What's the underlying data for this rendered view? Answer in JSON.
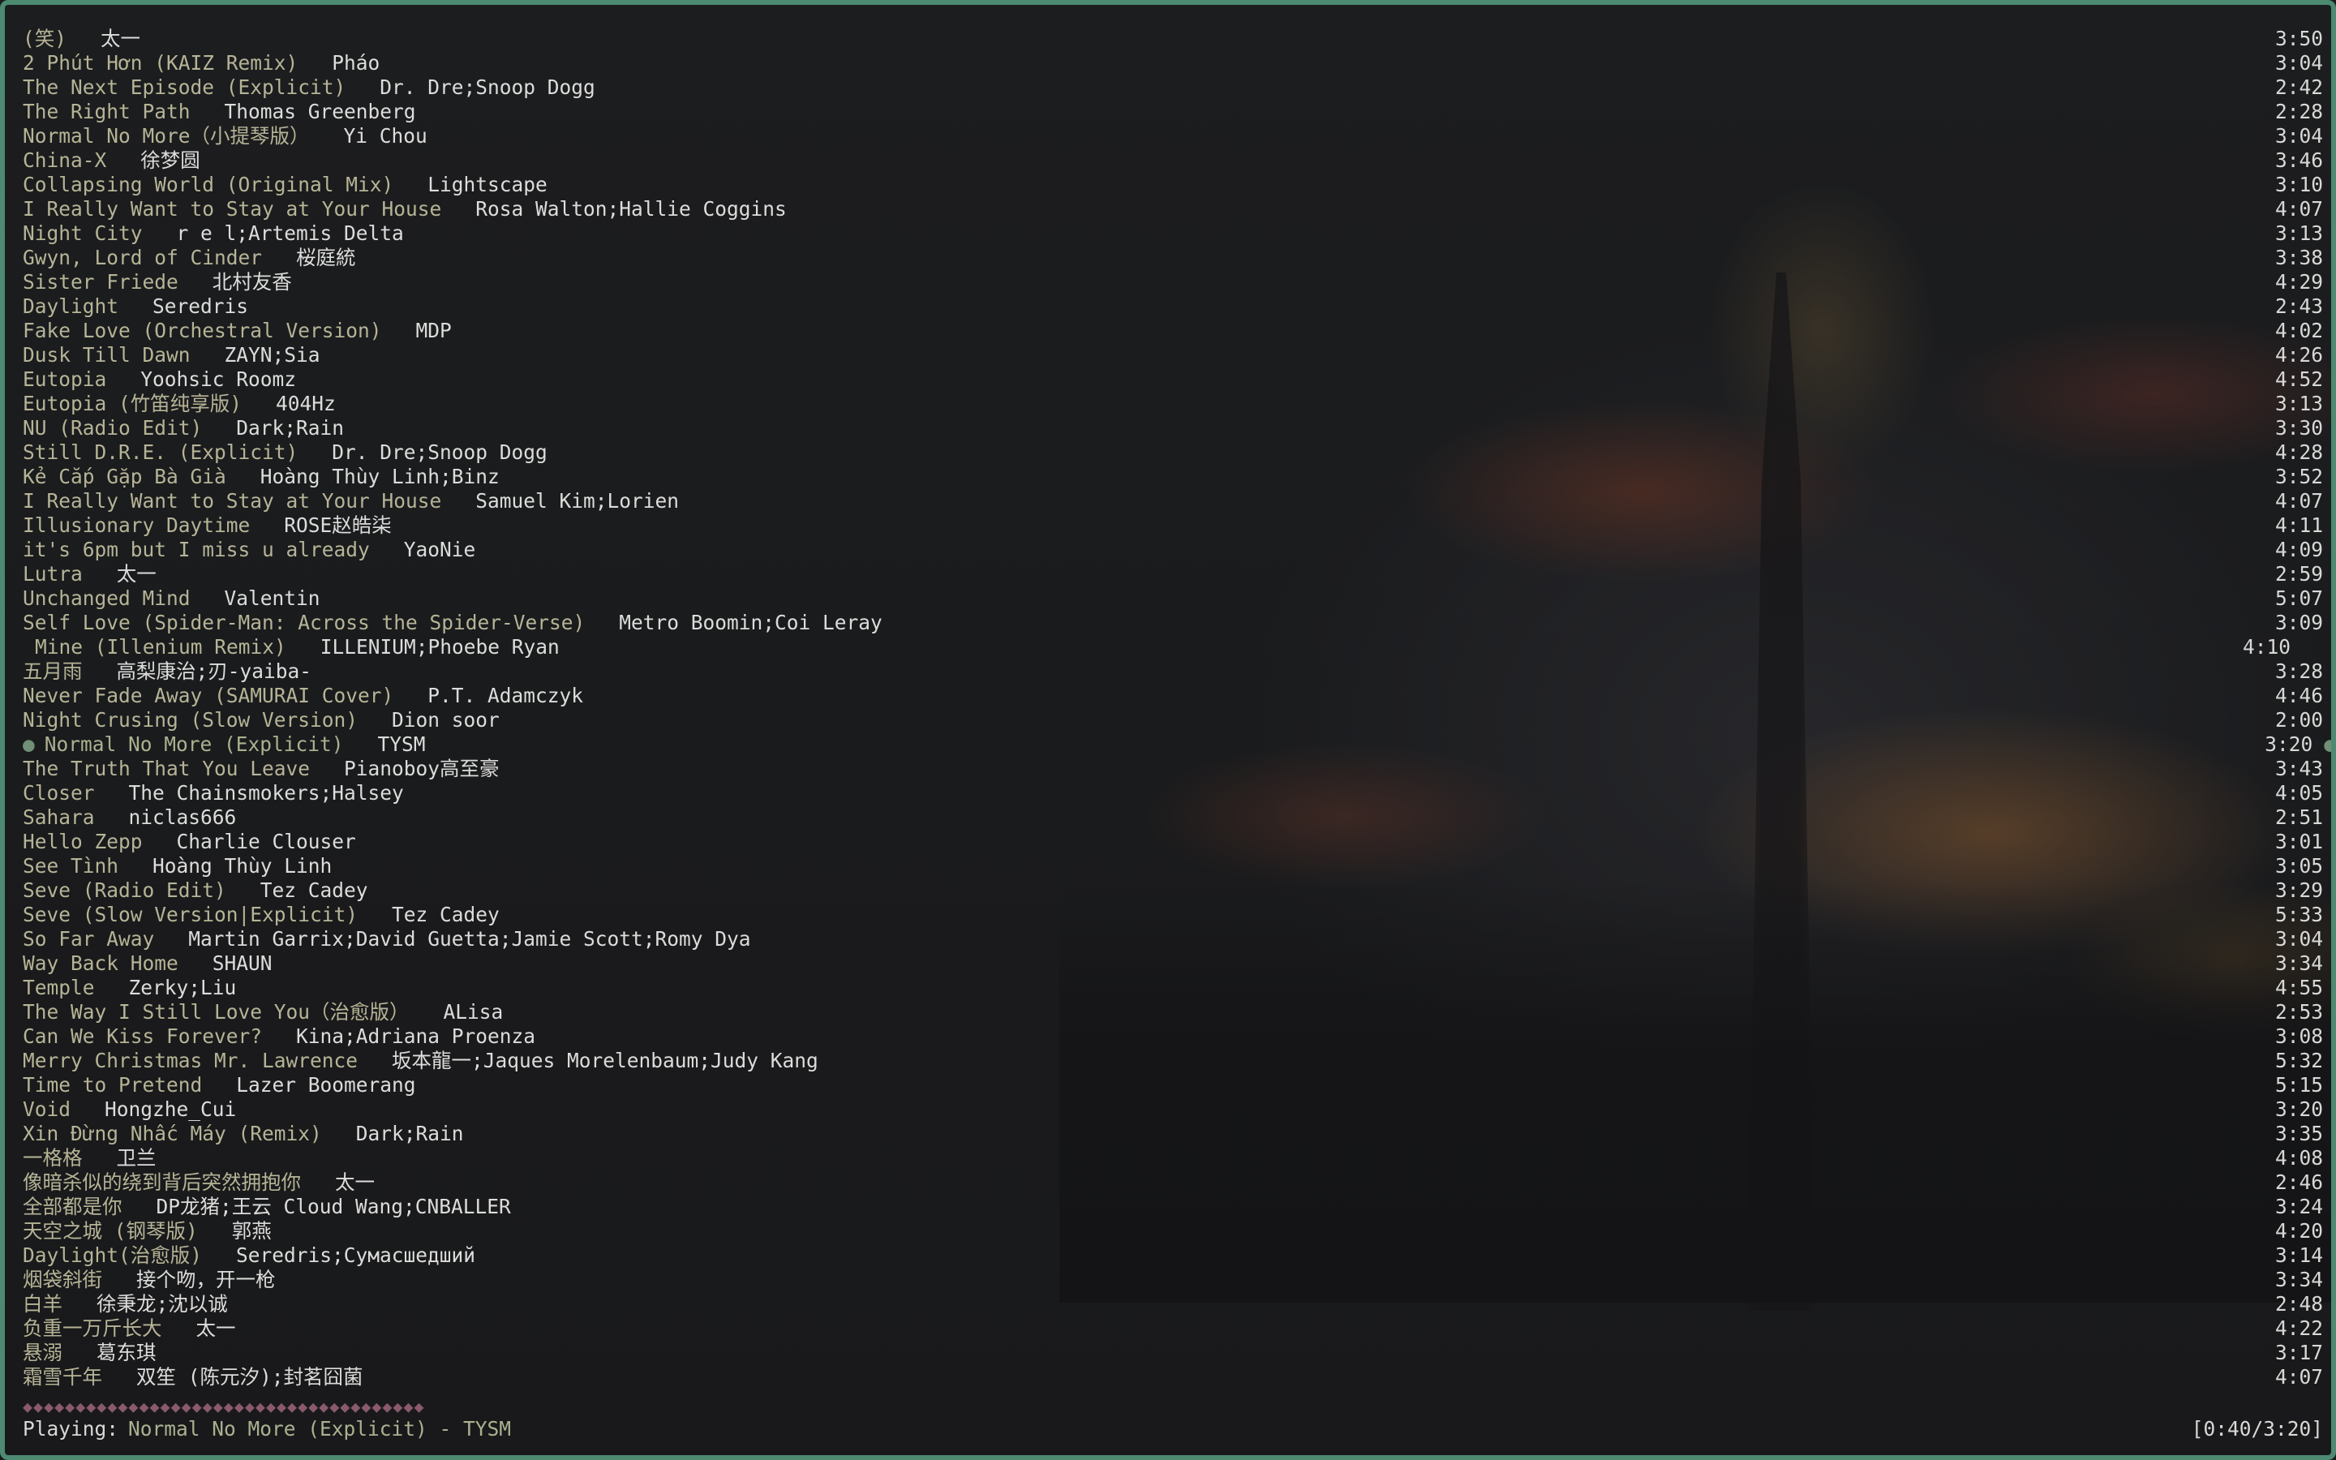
{
  "playlist": [
    {
      "title": "(笑)",
      "artist": "太一",
      "duration": "3:50"
    },
    {
      "title": "2 Phút Hơn (KAIZ Remix)",
      "artist": "Pháo",
      "duration": "3:04"
    },
    {
      "title": "The Next Episode (Explicit)",
      "artist": "Dr. Dre;Snoop Dogg",
      "duration": "2:42"
    },
    {
      "title": "The Right Path",
      "artist": "Thomas Greenberg",
      "duration": "2:28"
    },
    {
      "title": "Normal No More（小提琴版）",
      "artist": "Yi Chou",
      "duration": "3:04"
    },
    {
      "title": "China-X",
      "artist": "徐梦圆",
      "duration": "3:46"
    },
    {
      "title": "Collapsing World (Original Mix)",
      "artist": "Lightscape",
      "duration": "3:10"
    },
    {
      "title": "I Really Want to Stay at Your House",
      "artist": "Rosa Walton;Hallie Coggins",
      "duration": "4:07"
    },
    {
      "title": "Night City",
      "artist": "r e l;Artemis Delta",
      "duration": "3:13"
    },
    {
      "title": "Gwyn, Lord of Cinder",
      "artist": "桜庭統",
      "duration": "3:38"
    },
    {
      "title": "Sister Friede",
      "artist": "北村友香",
      "duration": "4:29"
    },
    {
      "title": "Daylight",
      "artist": "Seredris",
      "duration": "2:43"
    },
    {
      "title": "Fake Love (Orchestral Version)",
      "artist": "MDP",
      "duration": "4:02"
    },
    {
      "title": "Dusk Till Dawn",
      "artist": "ZAYN;Sia",
      "duration": "4:26"
    },
    {
      "title": "Eutopia",
      "artist": "Yoohsic Roomz",
      "duration": "4:52"
    },
    {
      "title": "Eutopia (竹笛纯享版)",
      "artist": "404Hz",
      "duration": "3:13"
    },
    {
      "title": "NU (Radio Edit)",
      "artist": "Dark;Rain",
      "duration": "3:30"
    },
    {
      "title": "Still D.R.E. (Explicit)",
      "artist": "Dr. Dre;Snoop Dogg",
      "duration": "4:28"
    },
    {
      "title": "Kẻ Cắp Gặp Bà Già",
      "artist": "Hoàng Thùy Linh;Binz",
      "duration": "3:52"
    },
    {
      "title": "I Really Want to Stay at Your House",
      "artist": "Samuel Kim;Lorien",
      "duration": "4:07"
    },
    {
      "title": "Illusionary Daytime",
      "artist": "ROSE赵皓柒",
      "duration": "4:11"
    },
    {
      "title": "it's 6pm but I miss u already",
      "artist": "YaoNie",
      "duration": "4:09"
    },
    {
      "title": "Lutra",
      "artist": "太一",
      "duration": "2:59"
    },
    {
      "title": "Unchanged Mind",
      "artist": "Valentin",
      "duration": "5:07"
    },
    {
      "title": "Self Love (Spider-Man: Across the Spider-Verse)",
      "artist": "Metro Boomin;Coi Leray",
      "duration": "3:09"
    },
    {
      "title": "Mine (Illenium Remix)",
      "artist": "ILLENIUM;Phoebe Ryan",
      "duration": "4:10"
    },
    {
      "title": "五月雨",
      "artist": "高梨康治;刃-yaiba-",
      "duration": "3:28"
    },
    {
      "title": "Never Fade Away (SAMURAI Cover)",
      "artist": "P.T. Adamczyk",
      "duration": "4:46"
    },
    {
      "title": "Night Crusing (Slow Version)",
      "artist": "Dion soor",
      "duration": "2:00"
    },
    {
      "title": "Normal No More (Explicit)",
      "artist": "TYSM",
      "duration": "3:20"
    },
    {
      "title": "The Truth That You Leave",
      "artist": "Pianoboy高至豪",
      "duration": "3:43"
    },
    {
      "title": "Closer",
      "artist": "The Chainsmokers;Halsey",
      "duration": "4:05"
    },
    {
      "title": "Sahara",
      "artist": "niclas666",
      "duration": "2:51"
    },
    {
      "title": "Hello Zepp",
      "artist": "Charlie Clouser",
      "duration": "3:01"
    },
    {
      "title": "See Tình",
      "artist": "Hoàng Thùy Linh",
      "duration": "3:05"
    },
    {
      "title": "Seve (Radio Edit)",
      "artist": "Tez Cadey",
      "duration": "3:29"
    },
    {
      "title": "Seve (Slow Version|Explicit)",
      "artist": "Tez Cadey",
      "duration": "5:33"
    },
    {
      "title": "So Far Away",
      "artist": "Martin Garrix;David Guetta;Jamie Scott;Romy Dya",
      "duration": "3:04"
    },
    {
      "title": "Way Back Home",
      "artist": "SHAUN",
      "duration": "3:34"
    },
    {
      "title": "Temple",
      "artist": "Zerky;Liu",
      "duration": "4:55"
    },
    {
      "title": "The Way I Still Love You（治愈版）",
      "artist": "ALisa",
      "duration": "2:53"
    },
    {
      "title": "Can We Kiss Forever?",
      "artist": "Kina;Adriana Proenza",
      "duration": "3:08"
    },
    {
      "title": "Merry Christmas Mr. Lawrence",
      "artist": "坂本龍一;Jaques Morelenbaum;Judy Kang",
      "duration": "5:32"
    },
    {
      "title": "Time to Pretend",
      "artist": "Lazer Boomerang",
      "duration": "5:15"
    },
    {
      "title": "Void",
      "artist": "Hongzhe_Cui",
      "duration": "3:20"
    },
    {
      "title": "Xin Đừng Nhấc Máy (Remix)",
      "artist": "Dark;Rain",
      "duration": "3:35"
    },
    {
      "title": "一格格",
      "artist": "卫兰",
      "duration": "4:08"
    },
    {
      "title": "像暗杀似的绕到背后突然拥抱你",
      "artist": "太一",
      "duration": "2:46"
    },
    {
      "title": "全部都是你",
      "artist": "DP龙猪;王云 Cloud Wang;CNBALLER",
      "duration": "3:24"
    },
    {
      "title": "天空之城 (钢琴版)",
      "artist": "郭燕",
      "duration": "4:20"
    },
    {
      "title": "Daylight(治愈版)",
      "artist": "Seredris;Сумасшедший",
      "duration": "3:14"
    },
    {
      "title": "烟袋斜街",
      "artist": "接个吻，开一枪",
      "duration": "3:34"
    },
    {
      "title": "白羊",
      "artist": "徐秉龙;沈以诚",
      "duration": "2:48"
    },
    {
      "title": "负重一万斤长大",
      "artist": "太一",
      "duration": "4:22"
    },
    {
      "title": "悬溺",
      "artist": "葛东琪",
      "duration": "3:17"
    },
    {
      "title": "霜雪千年",
      "artist": "双笙 (陈元汐);封茗囧菌",
      "duration": "4:07"
    }
  ],
  "current_index": 29,
  "current_marker": "●",
  "progress": {
    "bar": "◆◆◆◆◆◆◆◆◆◆◆◆◆◆◆◆◆◆◆◆◆◆◆◆◆◆◆◆◆◆◆◆◆◆◆◆◆◆",
    "fraction": 0.2083
  },
  "status": {
    "label": "Playing:",
    "track": "Normal No More (Explicit) - TYSM",
    "time": "[0:40/3:20]"
  },
  "colors": {
    "border": "#4c8a72",
    "title": "#b6b496",
    "artist": "#dcdcda",
    "now_playing": "#a9b28f",
    "progress": "#8a5a6a"
  }
}
